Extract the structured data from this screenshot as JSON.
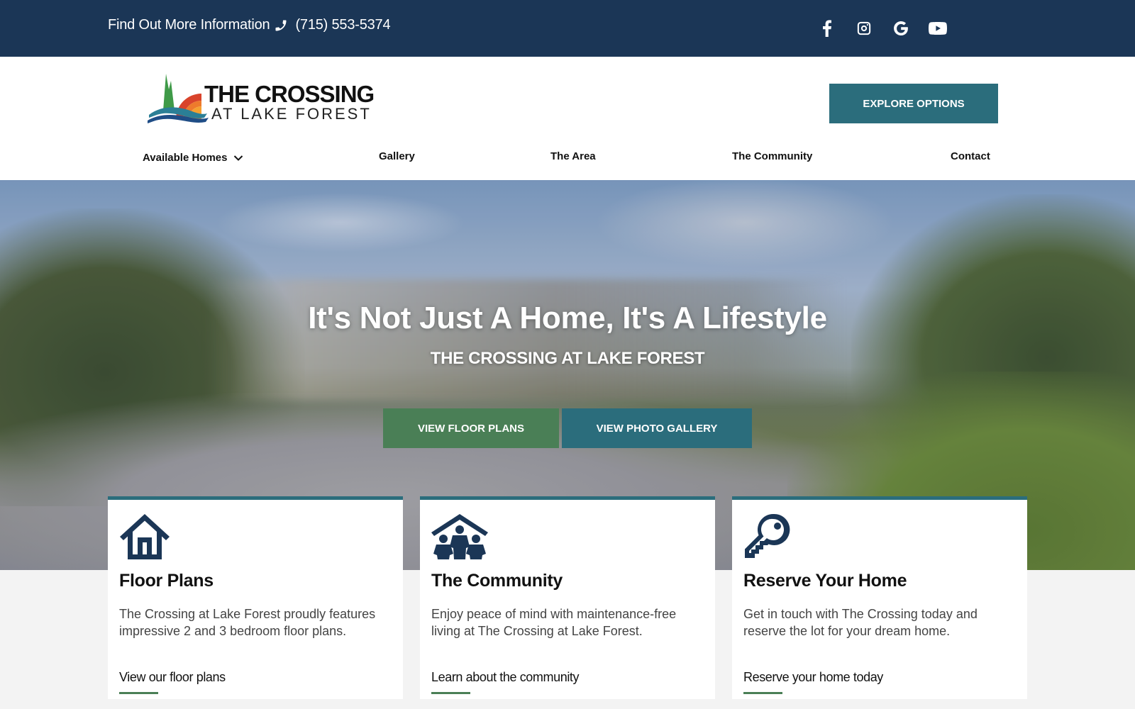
{
  "topbar": {
    "info_text": "Find Out More Information",
    "phone": "(715) 553-5374",
    "social": [
      {
        "name": "facebook-icon",
        "label": "Facebook"
      },
      {
        "name": "instagram-icon",
        "label": "Instagram"
      },
      {
        "name": "google-icon",
        "label": "Google"
      },
      {
        "name": "youtube-icon",
        "label": "YouTube"
      }
    ]
  },
  "header": {
    "logo": {
      "line1": "THE CROSSING",
      "line2": "AT LAKE FOREST"
    },
    "explore_button": "EXPLORE OPTIONS",
    "nav": [
      {
        "label": "Available Homes",
        "has_dropdown": true
      },
      {
        "label": "Gallery"
      },
      {
        "label": "The Area"
      },
      {
        "label": "The Community"
      },
      {
        "label": "Contact"
      }
    ]
  },
  "hero": {
    "title": "It's Not Just A Home, It's A Lifestyle",
    "subtitle": "THE CROSSING AT LAKE FOREST",
    "buttons": {
      "floor_plans": "VIEW FLOOR PLANS",
      "photo_gallery": "VIEW PHOTO GALLERY"
    }
  },
  "cards": [
    {
      "icon": "house-icon",
      "title": "Floor Plans",
      "text": "The Crossing at Lake Forest proudly features impressive 2 and 3 bedroom floor plans.",
      "link": "View our floor plans"
    },
    {
      "icon": "community-icon",
      "title": "The Community",
      "text": "Enjoy peace of mind with maintenance-free living at The Crossing at Lake Forest.",
      "link": "Learn about the community"
    },
    {
      "icon": "key-icon",
      "title": "Reserve Your Home",
      "text": "Get in touch with The Crossing today and reserve the lot for your dream home.",
      "link": "Reserve your home today"
    }
  ],
  "colors": {
    "navy": "#1b3656",
    "teal": "#2b6d7c",
    "green": "#4a7f56"
  }
}
